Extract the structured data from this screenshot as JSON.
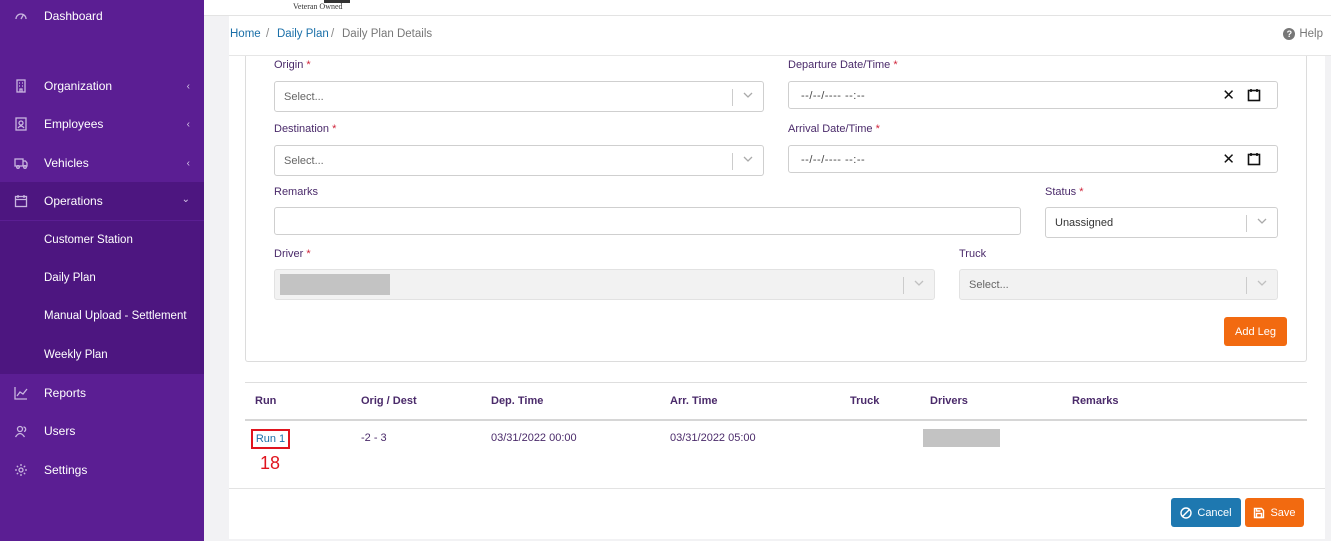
{
  "sidebar": {
    "items": [
      {
        "label": "Dashboard",
        "icon": "dashboard-icon",
        "has_chevron": false
      },
      {
        "label": "Organization",
        "icon": "building-icon",
        "has_chevron": true
      },
      {
        "label": "Employees",
        "icon": "employees-icon",
        "has_chevron": true
      },
      {
        "label": "Vehicles",
        "icon": "truck-icon",
        "has_chevron": true
      },
      {
        "label": "Operations",
        "icon": "calendar-icon",
        "has_chevron": true,
        "expanded": true
      },
      {
        "label": "Reports",
        "icon": "chart-line-icon",
        "has_chevron": false
      },
      {
        "label": "Users",
        "icon": "users-icon",
        "has_chevron": false
      },
      {
        "label": "Settings",
        "icon": "gear-icon",
        "has_chevron": false
      }
    ],
    "operations_sub": [
      "Customer Station",
      "Daily Plan",
      "Manual Upload - Settlement",
      "Weekly Plan"
    ],
    "chevron_left": "‹",
    "chevron_down": "⌄"
  },
  "logo": {
    "tagline": "Veteran Owned"
  },
  "breadcrumb": {
    "home": "Home",
    "daily_plan": "Daily Plan",
    "current": "Daily Plan Details",
    "sep": "/"
  },
  "help_label": "Help",
  "form": {
    "origin_label": "Origin",
    "origin_placeholder": "Select...",
    "destination_label": "Destination",
    "destination_placeholder": "Select...",
    "departure_label": "Departure Date/Time",
    "departure_value": "--/--/---- --:--",
    "arrival_label": "Arrival Date/Time",
    "arrival_value": "--/--/---- --:--",
    "remarks_label": "Remarks",
    "remarks_value": "",
    "status_label": "Status",
    "status_value": "Unassigned",
    "driver_label": "Driver",
    "truck_label": "Truck",
    "truck_placeholder": "Select...",
    "required_mark": "*",
    "clear_glyph": "✕",
    "add_leg_label": "Add Leg"
  },
  "table": {
    "headers": {
      "run": "Run",
      "orig_dest": "Orig / Dest",
      "dep_time": "Dep. Time",
      "arr_time": "Arr. Time",
      "truck": "Truck",
      "drivers": "Drivers",
      "remarks": "Remarks"
    },
    "row": {
      "run": "Run 1",
      "orig_dest": "-2 - 3",
      "dep_time": "03/31/2022 00:00",
      "arr_time": "03/31/2022 05:00",
      "truck": "",
      "remarks": ""
    }
  },
  "annotation_marker": "18",
  "footer": {
    "cancel_label": "Cancel",
    "save_label": "Save"
  },
  "colors": {
    "sidebar": "#5b1e93",
    "sidebar_active": "#4d1680",
    "accent_orange": "#f26a10",
    "accent_blue": "#1e78b0",
    "link": "#1a6fa8",
    "marker_red": "#e0141e"
  }
}
